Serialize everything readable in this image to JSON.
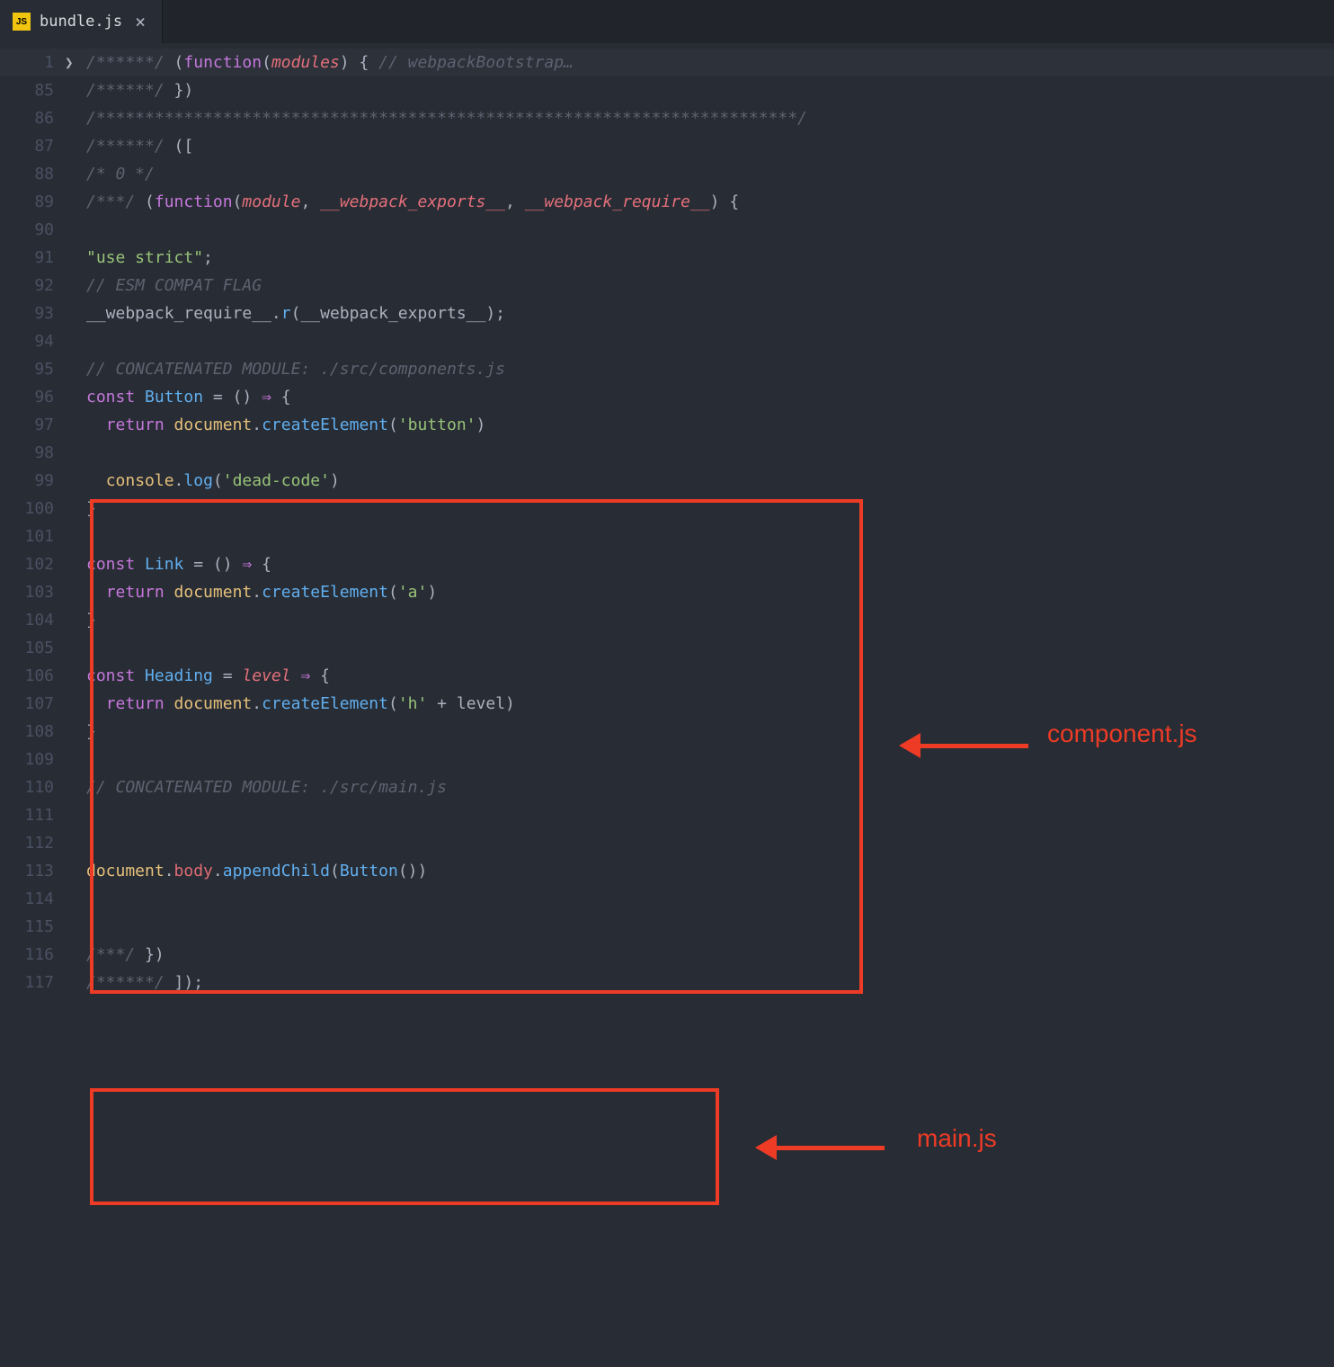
{
  "tab": {
    "icon_text": "JS",
    "filename": "bundle.js",
    "close": "×"
  },
  "lines": [
    {
      "num": "1",
      "fold": true,
      "hl": true,
      "tokens": [
        [
          "comment",
          "/******/ "
        ],
        [
          "punct",
          "("
        ],
        [
          "keyword",
          "function"
        ],
        [
          "punct",
          "("
        ],
        [
          "param",
          "modules"
        ],
        [
          "punct",
          ") { "
        ],
        [
          "comment",
          "// webpackBootstrap…"
        ]
      ]
    },
    {
      "num": "85",
      "tokens": [
        [
          "comment",
          "/******/ "
        ],
        [
          "punct",
          "})"
        ]
      ]
    },
    {
      "num": "86",
      "tokens": [
        [
          "comment",
          "/************************************************************************/"
        ]
      ]
    },
    {
      "num": "87",
      "tokens": [
        [
          "comment",
          "/******/ "
        ],
        [
          "punct",
          "(["
        ]
      ]
    },
    {
      "num": "88",
      "tokens": [
        [
          "comment",
          "/* 0 */"
        ]
      ]
    },
    {
      "num": "89",
      "tokens": [
        [
          "comment",
          "/***/ "
        ],
        [
          "punct",
          "("
        ],
        [
          "keyword",
          "function"
        ],
        [
          "punct",
          "("
        ],
        [
          "param",
          "module"
        ],
        [
          "punct",
          ", "
        ],
        [
          "param",
          "__webpack_exports__"
        ],
        [
          "punct",
          ", "
        ],
        [
          "param",
          "__webpack_require__"
        ],
        [
          "punct",
          ") {"
        ]
      ]
    },
    {
      "num": "90",
      "tokens": []
    },
    {
      "num": "91",
      "tokens": [
        [
          "string",
          "\"use strict\""
        ],
        [
          "punct",
          ";"
        ]
      ]
    },
    {
      "num": "92",
      "tokens": [
        [
          "comment",
          "// ESM COMPAT FLAG"
        ]
      ]
    },
    {
      "num": "93",
      "tokens": [
        [
          "const",
          "__webpack_require__"
        ],
        [
          "punct",
          "."
        ],
        [
          "func",
          "r"
        ],
        [
          "punct",
          "("
        ],
        [
          "const",
          "__webpack_exports__"
        ],
        [
          "punct",
          ");"
        ]
      ]
    },
    {
      "num": "94",
      "tokens": []
    },
    {
      "num": "95",
      "tokens": [
        [
          "comment",
          "// CONCATENATED MODULE: ./src/components.js"
        ]
      ]
    },
    {
      "num": "96",
      "tokens": [
        [
          "keyword",
          "const "
        ],
        [
          "func",
          "Button"
        ],
        [
          "const",
          " "
        ],
        [
          "punct",
          "= () "
        ],
        [
          "keyword",
          "⇒"
        ],
        [
          "punct",
          " {"
        ]
      ]
    },
    {
      "num": "97",
      "tokens": [
        [
          "const",
          "  "
        ],
        [
          "keyword",
          "return "
        ],
        [
          "var",
          "document"
        ],
        [
          "punct",
          "."
        ],
        [
          "func",
          "createElement"
        ],
        [
          "punct",
          "("
        ],
        [
          "string",
          "'button'"
        ],
        [
          "punct",
          ")"
        ]
      ]
    },
    {
      "num": "98",
      "tokens": []
    },
    {
      "num": "99",
      "tokens": [
        [
          "const",
          "  "
        ],
        [
          "var",
          "console"
        ],
        [
          "punct",
          "."
        ],
        [
          "func",
          "log"
        ],
        [
          "punct",
          "("
        ],
        [
          "string",
          "'dead-code'"
        ],
        [
          "punct",
          ")"
        ]
      ]
    },
    {
      "num": "100",
      "tokens": [
        [
          "punct",
          "}"
        ]
      ]
    },
    {
      "num": "101",
      "tokens": []
    },
    {
      "num": "102",
      "tokens": [
        [
          "keyword",
          "const "
        ],
        [
          "func",
          "Link"
        ],
        [
          "const",
          " "
        ],
        [
          "punct",
          "= () "
        ],
        [
          "keyword",
          "⇒"
        ],
        [
          "punct",
          " {"
        ]
      ]
    },
    {
      "num": "103",
      "tokens": [
        [
          "const",
          "  "
        ],
        [
          "keyword",
          "return "
        ],
        [
          "var",
          "document"
        ],
        [
          "punct",
          "."
        ],
        [
          "func",
          "createElement"
        ],
        [
          "punct",
          "("
        ],
        [
          "string",
          "'a'"
        ],
        [
          "punct",
          ")"
        ]
      ]
    },
    {
      "num": "104",
      "tokens": [
        [
          "punct",
          "}"
        ]
      ]
    },
    {
      "num": "105",
      "tokens": []
    },
    {
      "num": "106",
      "tokens": [
        [
          "keyword",
          "const "
        ],
        [
          "func",
          "Heading"
        ],
        [
          "const",
          " "
        ],
        [
          "punct",
          "= "
        ],
        [
          "param",
          "level"
        ],
        [
          "punct",
          " "
        ],
        [
          "keyword",
          "⇒"
        ],
        [
          "punct",
          " {"
        ]
      ]
    },
    {
      "num": "107",
      "tokens": [
        [
          "const",
          "  "
        ],
        [
          "keyword",
          "return "
        ],
        [
          "var",
          "document"
        ],
        [
          "punct",
          "."
        ],
        [
          "func",
          "createElement"
        ],
        [
          "punct",
          "("
        ],
        [
          "string",
          "'h'"
        ],
        [
          "punct",
          " + "
        ],
        [
          "const",
          "level"
        ],
        [
          "punct",
          ")"
        ]
      ]
    },
    {
      "num": "108",
      "tokens": [
        [
          "punct",
          "}"
        ]
      ]
    },
    {
      "num": "109",
      "tokens": []
    },
    {
      "num": "110",
      "tokens": [
        [
          "comment",
          "// CONCATENATED MODULE: ./src/main.js"
        ]
      ]
    },
    {
      "num": "111",
      "tokens": []
    },
    {
      "num": "112",
      "tokens": []
    },
    {
      "num": "113",
      "tokens": [
        [
          "var",
          "document"
        ],
        [
          "punct",
          "."
        ],
        [
          "prop",
          "body"
        ],
        [
          "punct",
          "."
        ],
        [
          "func",
          "appendChild"
        ],
        [
          "punct",
          "("
        ],
        [
          "func",
          "Button"
        ],
        [
          "punct",
          "())"
        ]
      ]
    },
    {
      "num": "114",
      "tokens": []
    },
    {
      "num": "115",
      "tokens": []
    },
    {
      "num": "116",
      "tokens": [
        [
          "comment",
          "/***/ "
        ],
        [
          "punct",
          "})"
        ]
      ]
    },
    {
      "num": "117",
      "tokens": [
        [
          "comment",
          "/******/ "
        ],
        [
          "punct",
          "]);"
        ]
      ]
    }
  ],
  "annotations": {
    "box1_label": "component.js",
    "box2_label": "main.js"
  }
}
